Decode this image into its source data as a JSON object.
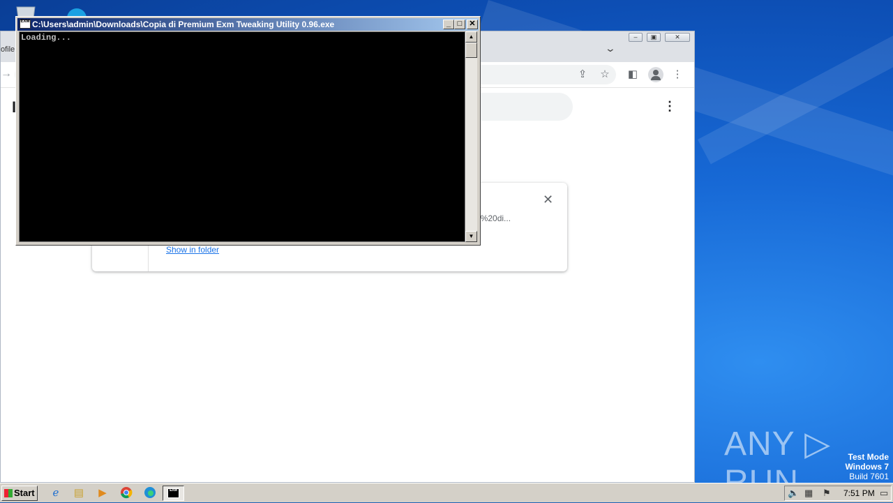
{
  "console": {
    "title": "C:\\Users\\admin\\Downloads\\Copia di Premium Exm Tweaking Utility 0.96.exe",
    "icon_text": "EXM",
    "output": "Loading...",
    "buttons": {
      "minimize": "_",
      "maximize": "□",
      "close": "✕"
    }
  },
  "browser": {
    "tab_fragment": "ofile",
    "heading_fragment": "I",
    "download_card": {
      "url_fragment": "a%20di...",
      "show_in_folder": "Show in folder"
    }
  },
  "desktop": {
    "watermark": "ANY ▷ RUN",
    "test_mode": [
      "Test Mode",
      "Windows 7",
      "Build 7601"
    ]
  },
  "taskbar": {
    "start_label": "Start",
    "pinned": [
      {
        "icon": "ie-icon"
      },
      {
        "icon": "explorer-icon"
      },
      {
        "icon": "media-player-icon"
      },
      {
        "icon": "chrome-icon"
      },
      {
        "icon": "edge-icon"
      },
      {
        "icon": "exm-console-icon"
      }
    ],
    "clock": "7:51 PM"
  },
  "colors": {
    "console_title_start": "#0a246a",
    "console_title_end": "#a6caf0",
    "desktop_blue": "#1769d6",
    "link_blue": "#1a73e8"
  }
}
